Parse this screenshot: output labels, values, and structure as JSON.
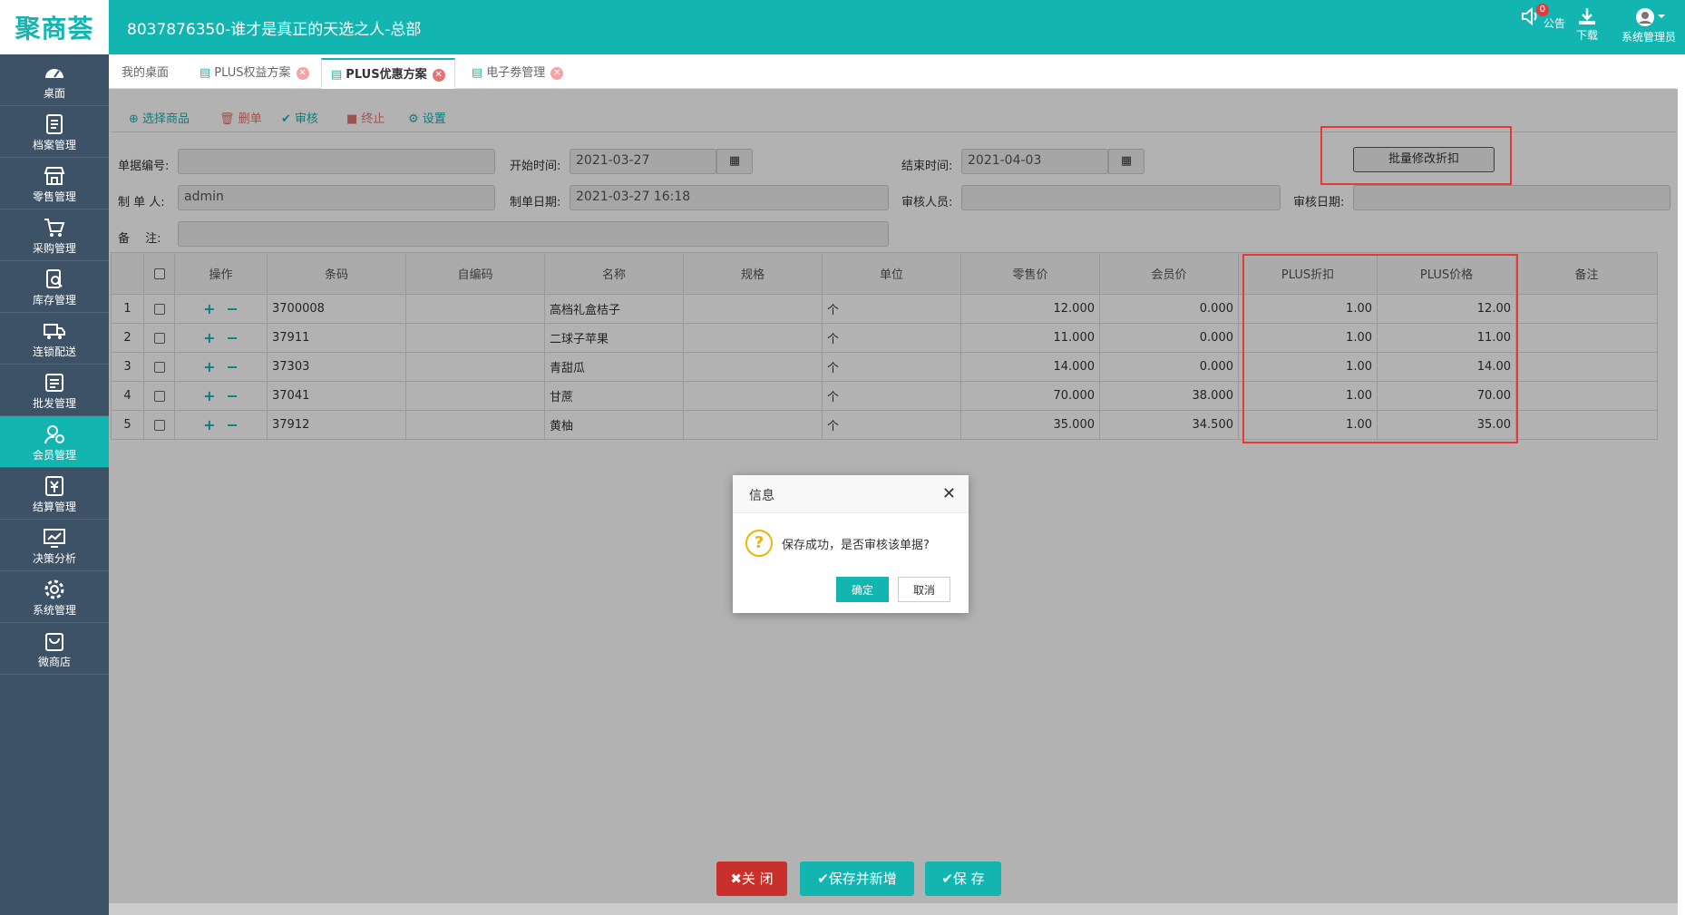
{
  "header": {
    "logo": "聚商荟",
    "title": "8037876350-谁才是真正的天选之人-总部",
    "notice_label": "公告",
    "notice_badge": "0",
    "download_label": "下载",
    "user_label": "系统管理员"
  },
  "sidebar": {
    "items": [
      {
        "label": "桌面",
        "icon": "dashboard-icon"
      },
      {
        "label": "档案管理",
        "icon": "archive-icon"
      },
      {
        "label": "零售管理",
        "icon": "store-icon"
      },
      {
        "label": "采购管理",
        "icon": "cart-icon"
      },
      {
        "label": "库存管理",
        "icon": "inventory-icon"
      },
      {
        "label": "连锁配送",
        "icon": "truck-icon"
      },
      {
        "label": "批发管理",
        "icon": "wholesale-icon"
      },
      {
        "label": "会员管理",
        "icon": "member-icon"
      },
      {
        "label": "结算管理",
        "icon": "settlement-icon"
      },
      {
        "label": "决策分析",
        "icon": "analysis-icon"
      },
      {
        "label": "系统管理",
        "icon": "gear-icon"
      },
      {
        "label": "微商店",
        "icon": "shop-bag-icon"
      }
    ]
  },
  "tabs": [
    {
      "label": "我的桌面"
    },
    {
      "label": "PLUS权益方案"
    },
    {
      "label": "PLUS优惠方案"
    },
    {
      "label": "电子劵管理"
    }
  ],
  "toolbar": {
    "select_goods": "选择商品",
    "delete": "删单",
    "audit": "审核",
    "stop": "终止",
    "settings": "设置"
  },
  "form": {
    "doc_no_label": "单据编号:",
    "doc_no_value": "",
    "start_label": "开始时间:",
    "start_value": "2021-03-27",
    "end_label": "结束时间:",
    "end_value": "2021-04-03",
    "batch_button": "批量修改折扣",
    "maker_label": "制 单 人:",
    "maker_value": "admin",
    "make_date_label": "制单日期:",
    "make_date_value": "2021-03-27 16:18",
    "auditor_label": "审核人员:",
    "auditor_value": "",
    "audit_date_label": "审核日期:",
    "audit_date_value": "",
    "remark_label": "备　 注:",
    "remark_value": ""
  },
  "table": {
    "headers": [
      "操作",
      "条码",
      "自编码",
      "名称",
      "规格",
      "单位",
      "零售价",
      "会员价",
      "PLUS折扣",
      "PLUS价格",
      "备注"
    ],
    "rows": [
      {
        "no": "1",
        "barcode": "3700008",
        "code": "",
        "name": "高档礼盒桔子",
        "spec": "",
        "unit": "个",
        "retail": "12.000",
        "member": "0.000",
        "discount": "1.00",
        "plus_price": "12.00",
        "remark": ""
      },
      {
        "no": "2",
        "barcode": "37911",
        "code": "",
        "name": "二球子苹果",
        "spec": "",
        "unit": "个",
        "retail": "11.000",
        "member": "0.000",
        "discount": "1.00",
        "plus_price": "11.00",
        "remark": ""
      },
      {
        "no": "3",
        "barcode": "37303",
        "code": "",
        "name": "青甜瓜",
        "spec": "",
        "unit": "个",
        "retail": "14.000",
        "member": "0.000",
        "discount": "1.00",
        "plus_price": "14.00",
        "remark": ""
      },
      {
        "no": "4",
        "barcode": "37041",
        "code": "",
        "name": "甘蔗",
        "spec": "",
        "unit": "个",
        "retail": "70.000",
        "member": "38.000",
        "discount": "1.00",
        "plus_price": "70.00",
        "remark": ""
      },
      {
        "no": "5",
        "barcode": "37912",
        "code": "",
        "name": "黄柚",
        "spec": "",
        "unit": "个",
        "retail": "35.000",
        "member": "34.500",
        "discount": "1.00",
        "plus_price": "35.00",
        "remark": ""
      }
    ]
  },
  "dialog": {
    "title": "信息",
    "message": "保存成功，是否审核该单据?",
    "ok": "确定",
    "cancel": "取消"
  },
  "footer": {
    "close": "关 闭",
    "save_new": "保存并新增",
    "save": "保 存"
  },
  "colors": {
    "accent": "#13b5b1",
    "sidebar_bg": "#3d5266",
    "highlight": "#e53935",
    "danger": "#c9302c"
  }
}
